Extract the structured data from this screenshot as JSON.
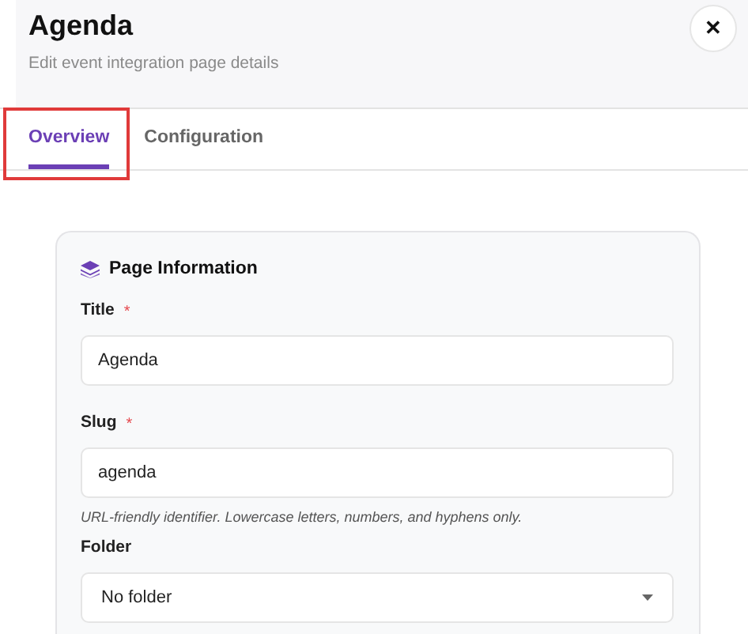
{
  "header": {
    "title": "Agenda",
    "subtitle": "Edit event integration page details",
    "close": "✕"
  },
  "tabs": [
    {
      "label": "Overview",
      "selected": true,
      "annotated": true
    },
    {
      "label": "Configuration",
      "selected": false,
      "annotated": false
    }
  ],
  "card": {
    "title": "Page Information",
    "fields": [
      {
        "kind": "text",
        "label": "Title",
        "required_mark": "*",
        "value": "Agenda"
      },
      {
        "kind": "text",
        "label": "Slug",
        "required_mark": "*",
        "value": "agenda",
        "hint": "URL-friendly identifier. Lowercase letters, numbers, and hyphens only."
      },
      {
        "kind": "select",
        "label": "Folder",
        "value": "No folder"
      }
    ]
  }
}
